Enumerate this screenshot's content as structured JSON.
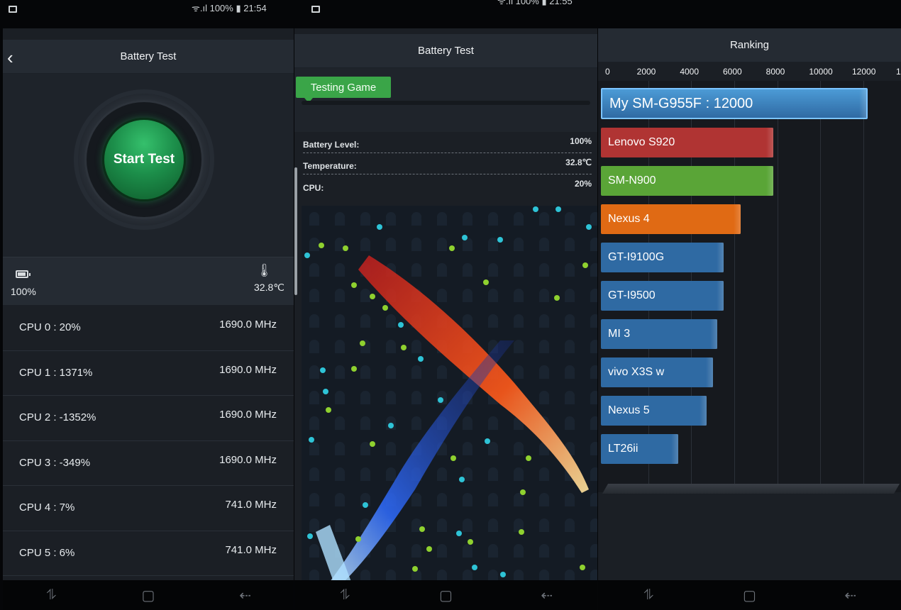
{
  "panel1": {
    "status_text": "100% ▮ 21:54",
    "title": "Battery Test",
    "start_button": "Start Test",
    "battery_level": "100%",
    "temperature": "32.8℃",
    "cpus": [
      {
        "label": "CPU 0 : 20%",
        "freq": "1690.0 MHz"
      },
      {
        "label": "CPU 1 : 1371%",
        "freq": "1690.0 MHz"
      },
      {
        "label": "CPU 2 : -1352%",
        "freq": "1690.0 MHz"
      },
      {
        "label": "CPU 3 : -349%",
        "freq": "1690.0 MHz"
      },
      {
        "label": "CPU 4 : 7%",
        "freq": "741.0 MHz"
      },
      {
        "label": "CPU 5 : 6%",
        "freq": "741.0 MHz"
      }
    ]
  },
  "panel2": {
    "status_text": "100% ▮ 21:55",
    "title": "Battery Test",
    "tag": "Testing Game",
    "stats": [
      {
        "key": "Battery Level:",
        "value": "100%"
      },
      {
        "key": "Temperature:",
        "value": "32.8℃"
      },
      {
        "key": "CPU:",
        "value": "20%"
      }
    ]
  },
  "panel3": {
    "title": "Ranking",
    "axis_ticks": [
      "0",
      "2000",
      "4000",
      "6000",
      "8000",
      "10000",
      "12000",
      "1"
    ],
    "bars": [
      {
        "label": "My SM-G955F : 12000",
        "score": 12000,
        "color": "#3f88c4"
      },
      {
        "label": "Lenovo S920",
        "score": 8000,
        "color": "#b03433"
      },
      {
        "label": "SM-N900",
        "score": 8000,
        "color": "#5aa537"
      },
      {
        "label": "Nexus 4",
        "score": 6500,
        "color": "#e06a14"
      },
      {
        "label": "GT-I9100G",
        "score": 5700,
        "color": "#2f6aa3"
      },
      {
        "label": "GT-I9500",
        "score": 5700,
        "color": "#2f6aa3"
      },
      {
        "label": "MI 3",
        "score": 5400,
        "color": "#2f6aa3"
      },
      {
        "label": "vivo X3S w",
        "score": 5200,
        "color": "#2f6aa3"
      },
      {
        "label": "Nexus 5",
        "score": 4900,
        "color": "#2f6aa3"
      },
      {
        "label": "LT26ii",
        "score": 3600,
        "color": "#2f6aa3"
      }
    ]
  },
  "navbar_icons": [
    "recent-apps-icon",
    "home-icon",
    "back-icon"
  ]
}
